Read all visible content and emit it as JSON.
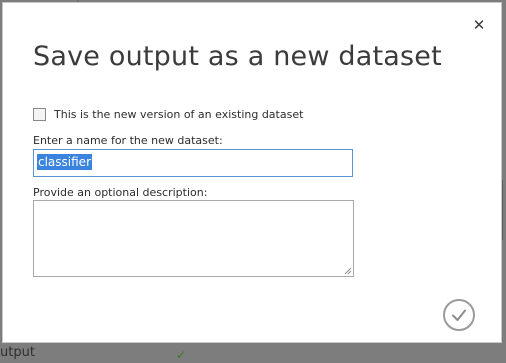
{
  "dialog": {
    "title": "Save output as a new dataset",
    "close_icon": "close-icon",
    "checkbox": {
      "label": "This is the new version of an existing dataset",
      "checked": false
    },
    "name_field": {
      "label": "Enter a name for the new dataset:",
      "value": "classifier",
      "selected": true
    },
    "description_field": {
      "label": "Provide an optional description:",
      "value": ""
    },
    "confirm_icon": "checkmark-icon"
  },
  "background": {
    "partial_text": "utput",
    "status_icon": "green-check-icon"
  },
  "colors": {
    "backdrop": "#7d7d7d",
    "focus_border": "#5b93d6",
    "selection": "#3a84e0",
    "title_text": "#3b3b3b"
  }
}
